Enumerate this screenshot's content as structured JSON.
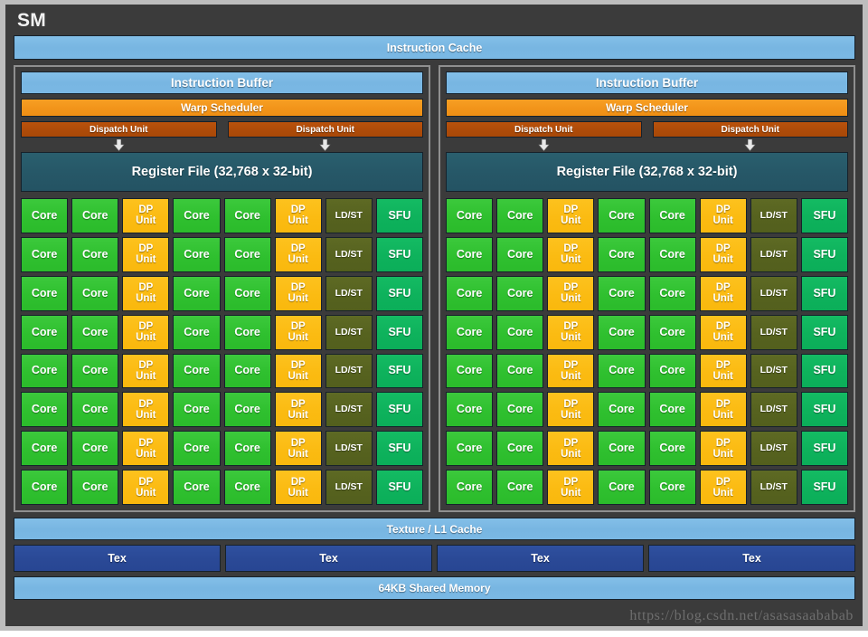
{
  "diagram": {
    "title": "SM",
    "instruction_cache": "Instruction Cache",
    "texture_l1_cache": "Texture / L1 Cache",
    "shared_memory": "64KB Shared Memory",
    "watermark": "https://blog.csdn.net/asasasaababab",
    "tex_blocks": [
      "Tex",
      "Tex",
      "Tex",
      "Tex"
    ],
    "partitions": [
      {
        "instruction_buffer": "Instruction Buffer",
        "warp_scheduler": "Warp Scheduler",
        "dispatch_units": [
          "Dispatch Unit",
          "Dispatch Unit"
        ],
        "register_file": "Register File (32,768 x 32-bit)"
      },
      {
        "instruction_buffer": "Instruction Buffer",
        "warp_scheduler": "Warp Scheduler",
        "dispatch_units": [
          "Dispatch Unit",
          "Dispatch Unit"
        ],
        "register_file": "Register File (32,768 x 32-bit)"
      }
    ],
    "core_grid": {
      "rows": 8,
      "columns": 8,
      "column_types": [
        "core",
        "core",
        "dp",
        "core",
        "core",
        "dp",
        "ldst",
        "sfu"
      ],
      "unit_labels": {
        "core": [
          "Core"
        ],
        "dp": [
          "DP",
          "Unit"
        ],
        "ldst": [
          "LD/ST"
        ],
        "sfu": [
          "SFU"
        ]
      }
    },
    "colors": {
      "background": "#3b3b3b",
      "frame_border": "#bdbdbd",
      "partition_border": "#8f8f8f",
      "light_blue": "#7ab8e4",
      "orange": "#f2941a",
      "dark_orange": "#ad4b09",
      "teal": "#265767",
      "core_green": "#2fc02f",
      "dp_amber": "#fbbb12",
      "ldst_olive": "#56621f",
      "sfu_green": "#0eb25c",
      "tex_blue": "#2a4996",
      "text": "#ffffff",
      "watermark": "#6e6e6e"
    }
  }
}
